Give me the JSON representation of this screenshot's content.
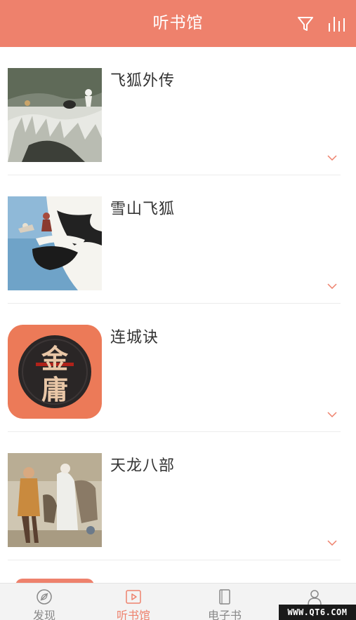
{
  "header": {
    "title": "听书馆",
    "filter_icon": "filter-icon",
    "stats_icon": "bar-chart-icon",
    "background": "#ee816c"
  },
  "books": [
    {
      "title": "飞狐外传",
      "cover": "ink-painting-cover"
    },
    {
      "title": "雪山飞狐",
      "cover": "snow-mountain-cover"
    },
    {
      "title": "连城诀",
      "cover": "jinyong-logo-cover",
      "cover_text": [
        "金",
        "庸"
      ]
    },
    {
      "title": "天龙八部",
      "cover": "illustration-cover"
    }
  ],
  "nav": {
    "items": [
      {
        "label": "发现",
        "icon": "leaf-icon",
        "active": false
      },
      {
        "label": "听书馆",
        "icon": "play-icon",
        "active": true
      },
      {
        "label": "电子书",
        "icon": "book-icon",
        "active": false
      },
      {
        "label": "我的",
        "icon": "user-icon",
        "active": false
      }
    ],
    "active_color": "#ee816c"
  },
  "watermark": "WWW.QT6.COM"
}
